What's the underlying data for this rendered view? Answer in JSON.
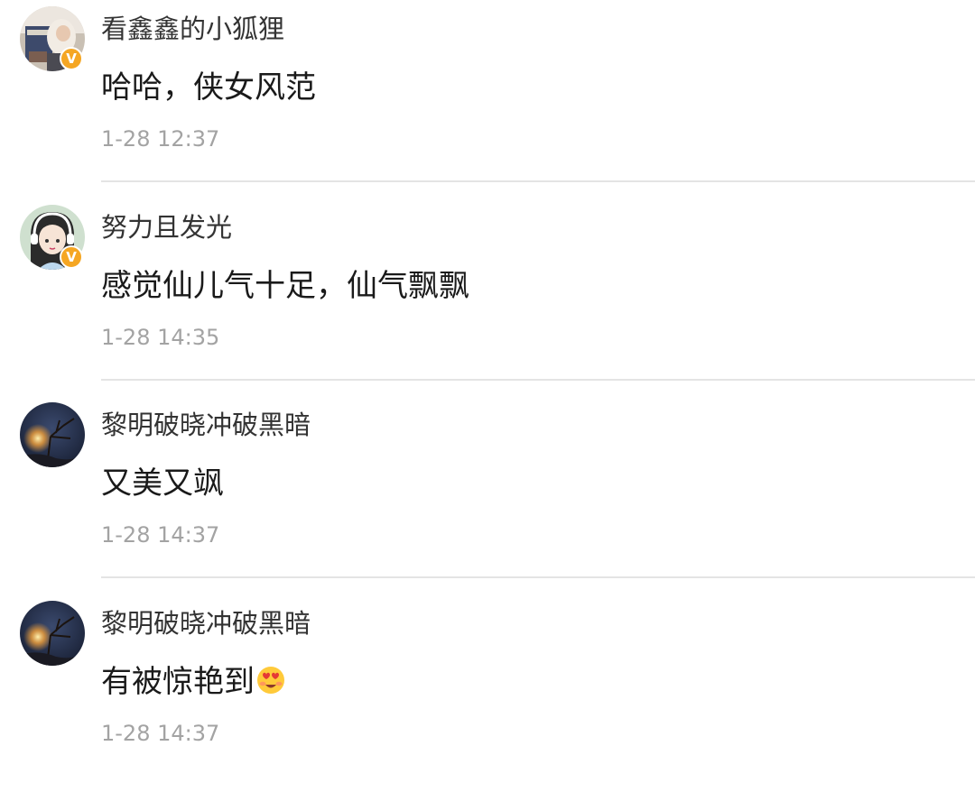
{
  "comments": [
    {
      "username": "看鑫鑫的小狐狸",
      "content": "哈哈，侠女风范",
      "time": "1-28 12:37",
      "verified": true,
      "avatar": "magazine-photo-avatar"
    },
    {
      "username": "努力且发光",
      "content": "感觉仙儿气十足，仙气飘飘",
      "time": "1-28 14:35",
      "verified": true,
      "avatar": "cartoon-girl-headphones-avatar"
    },
    {
      "username": "黎明破晓冲破黑暗",
      "content": "又美又飒",
      "time": "1-28 14:37",
      "verified": false,
      "avatar": "night-streetlight-avatar"
    },
    {
      "username": "黎明破晓冲破黑暗",
      "content": "有被惊艳到",
      "emoji": "heart-eyes-face-emoji",
      "time": "1-28 14:37",
      "verified": false,
      "avatar": "night-streetlight-avatar"
    }
  ],
  "colors": {
    "verified_badge": "#f5a623",
    "username": "#333333",
    "content": "#1a1a1a",
    "timestamp": "#a3a3a3",
    "divider": "#e4e4e4"
  }
}
